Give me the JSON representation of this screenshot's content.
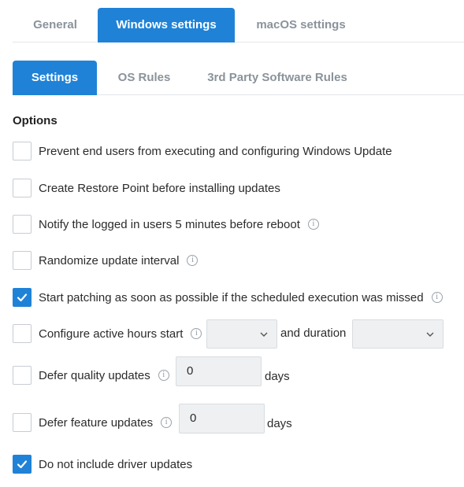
{
  "top_tabs": [
    {
      "label": "General",
      "active": false
    },
    {
      "label": "Windows settings",
      "active": true
    },
    {
      "label": "macOS settings",
      "active": false
    }
  ],
  "sub_tabs": [
    {
      "label": "Settings",
      "active": true
    },
    {
      "label": "OS Rules",
      "active": false
    },
    {
      "label": "3rd Party Software Rules",
      "active": false
    }
  ],
  "section_title": "Options",
  "options": [
    {
      "label": "Prevent end users from executing and configuring Windows Update",
      "checked": false
    },
    {
      "label": "Create Restore Point before installing updates",
      "checked": false
    },
    {
      "label": "Notify the logged in users 5 minutes before reboot",
      "checked": false,
      "info": true
    },
    {
      "label": "Randomize update interval",
      "checked": false,
      "info": true
    },
    {
      "label": "Start patching as soon as possible if the scheduled execution was missed",
      "checked": true,
      "info": true
    },
    {
      "label": "Configure active hours start",
      "checked": false,
      "info": true,
      "start_value": "",
      "connector": "and duration",
      "duration_value": ""
    },
    {
      "label": "Defer quality updates",
      "checked": false,
      "info": true,
      "value": "0",
      "unit": "days"
    },
    {
      "label": "Defer feature updates",
      "checked": false,
      "info": true,
      "value": "0",
      "unit": "days"
    },
    {
      "label": "Do not include driver updates",
      "checked": true
    }
  ],
  "colors": {
    "accent": "#1f82d7",
    "inactive_tab_text": "#8a939b",
    "input_bg": "#eef0f2"
  },
  "icons": {
    "check": "checkmark-icon",
    "info": "info-icon",
    "chevron": "chevron-down-icon"
  }
}
